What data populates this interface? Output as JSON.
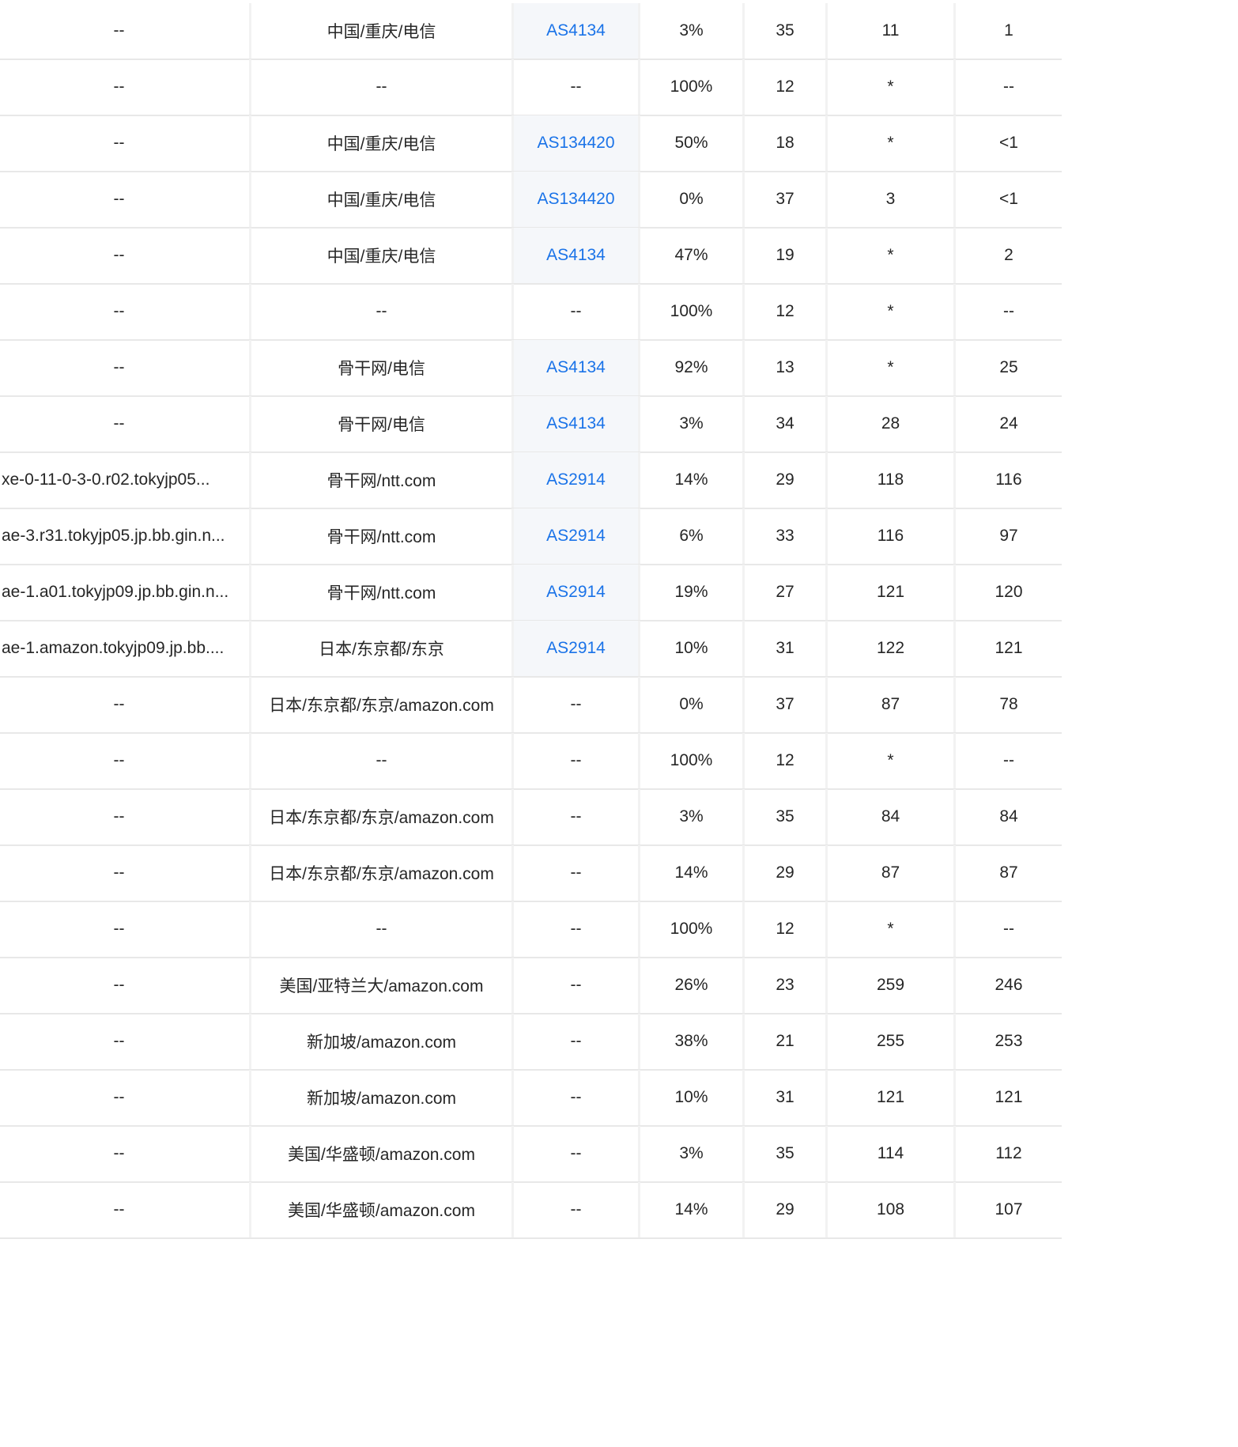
{
  "rows": [
    {
      "host": "--",
      "geo": "中国/重庆/电信",
      "asn": "AS4134",
      "loss": "3%",
      "sent": "35",
      "last": "11",
      "best": "1"
    },
    {
      "host": "--",
      "geo": "--",
      "asn": "--",
      "loss": "100%",
      "sent": "12",
      "last": "*",
      "best": "--"
    },
    {
      "host": "--",
      "geo": "中国/重庆/电信",
      "asn": "AS134420",
      "loss": "50%",
      "sent": "18",
      "last": "*",
      "best": "<1"
    },
    {
      "host": "--",
      "geo": "中国/重庆/电信",
      "asn": "AS134420",
      "loss": "0%",
      "sent": "37",
      "last": "3",
      "best": "<1"
    },
    {
      "host": "--",
      "geo": "中国/重庆/电信",
      "asn": "AS4134",
      "loss": "47%",
      "sent": "19",
      "last": "*",
      "best": "2"
    },
    {
      "host": "--",
      "geo": "--",
      "asn": "--",
      "loss": "100%",
      "sent": "12",
      "last": "*",
      "best": "--"
    },
    {
      "host": "--",
      "geo": "骨干网/电信",
      "asn": "AS4134",
      "loss": "92%",
      "sent": "13",
      "last": "*",
      "best": "25"
    },
    {
      "host": "--",
      "geo": "骨干网/电信",
      "asn": "AS4134",
      "loss": "3%",
      "sent": "34",
      "last": "28",
      "best": "24"
    },
    {
      "host": "xe-0-11-0-3-0.r02.tokyjp05...",
      "geo": "骨干网/ntt.com",
      "asn": "AS2914",
      "loss": "14%",
      "sent": "29",
      "last": "118",
      "best": "116"
    },
    {
      "host": "ae-3.r31.tokyjp05.jp.bb.gin.n...",
      "geo": "骨干网/ntt.com",
      "asn": "AS2914",
      "loss": "6%",
      "sent": "33",
      "last": "116",
      "best": "97"
    },
    {
      "host": "ae-1.a01.tokyjp09.jp.bb.gin.n...",
      "geo": "骨干网/ntt.com",
      "asn": "AS2914",
      "loss": "19%",
      "sent": "27",
      "last": "121",
      "best": "120"
    },
    {
      "host": "ae-1.amazon.tokyjp09.jp.bb....",
      "geo": "日本/东京都/东京",
      "asn": "AS2914",
      "loss": "10%",
      "sent": "31",
      "last": "122",
      "best": "121"
    },
    {
      "host": "--",
      "geo": "日本/东京都/东京/amazon.com",
      "asn": "--",
      "loss": "0%",
      "sent": "37",
      "last": "87",
      "best": "78"
    },
    {
      "host": "--",
      "geo": "--",
      "asn": "--",
      "loss": "100%",
      "sent": "12",
      "last": "*",
      "best": "--"
    },
    {
      "host": "--",
      "geo": "日本/东京都/东京/amazon.com",
      "asn": "--",
      "loss": "3%",
      "sent": "35",
      "last": "84",
      "best": "84"
    },
    {
      "host": "--",
      "geo": "日本/东京都/东京/amazon.com",
      "asn": "--",
      "loss": "14%",
      "sent": "29",
      "last": "87",
      "best": "87"
    },
    {
      "host": "--",
      "geo": "--",
      "asn": "--",
      "loss": "100%",
      "sent": "12",
      "last": "*",
      "best": "--"
    },
    {
      "host": "--",
      "geo": "美国/亚特兰大/amazon.com",
      "asn": "--",
      "loss": "26%",
      "sent": "23",
      "last": "259",
      "best": "246"
    },
    {
      "host": "--",
      "geo": "新加坡/amazon.com",
      "asn": "--",
      "loss": "38%",
      "sent": "21",
      "last": "255",
      "best": "253"
    },
    {
      "host": "--",
      "geo": "新加坡/amazon.com",
      "asn": "--",
      "loss": "10%",
      "sent": "31",
      "last": "121",
      "best": "121"
    },
    {
      "host": "--",
      "geo": "美国/华盛顿/amazon.com",
      "asn": "--",
      "loss": "3%",
      "sent": "35",
      "last": "114",
      "best": "112"
    },
    {
      "host": "--",
      "geo": "美国/华盛顿/amazon.com",
      "asn": "--",
      "loss": "14%",
      "sent": "29",
      "last": "108",
      "best": "107"
    }
  ],
  "colors": {
    "link": "#1a73e8",
    "text": "#262626",
    "row_border": "#e8e8e8",
    "asn_bg": "#f5f7fa"
  }
}
